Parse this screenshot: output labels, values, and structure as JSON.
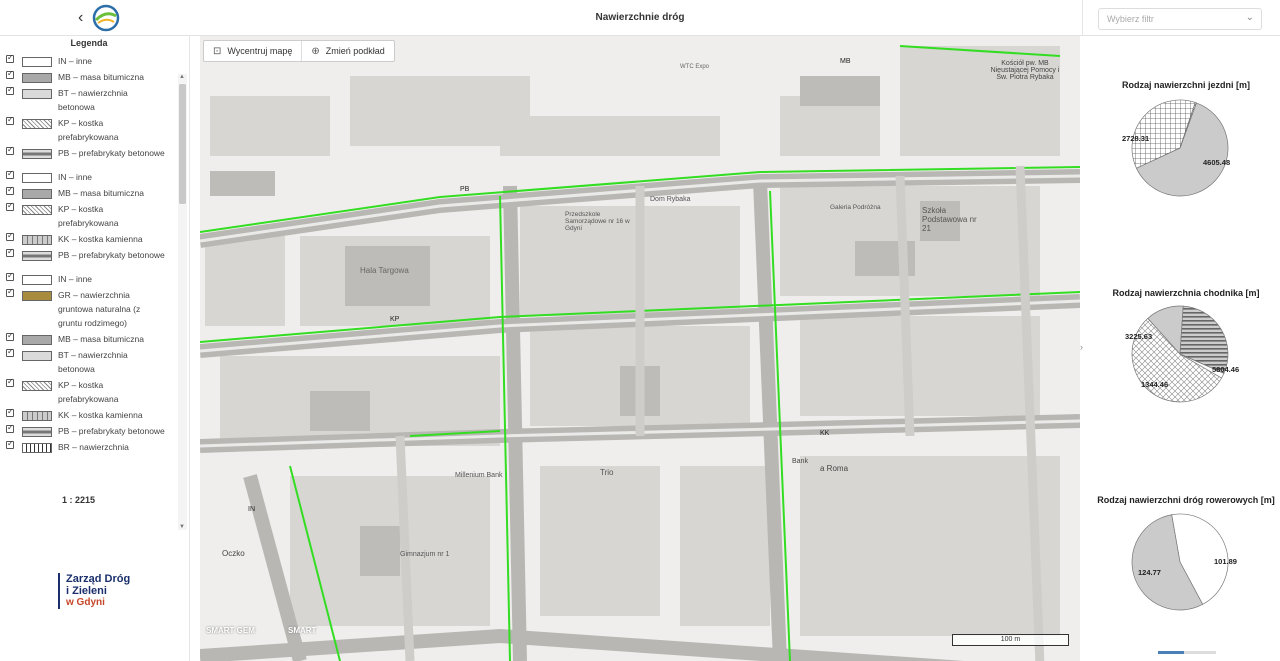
{
  "header": {
    "title": "Nawierzchnie dróg",
    "back_icon": "chevron-left-icon",
    "logo_icon": "app-logo-icon"
  },
  "filter": {
    "placeholder": "Wybierz filtr"
  },
  "legend": {
    "title": "Legenda",
    "groups": [
      {
        "items": [
          {
            "label": "IN – inne",
            "swatch": "white"
          },
          {
            "label": "MB – masa bitumiczna",
            "swatch": "mb"
          },
          {
            "label": "BT – nawierzchnia betonowa",
            "swatch": "bt"
          },
          {
            "label": "KP – kostka prefabrykowana",
            "swatch": "kp"
          },
          {
            "label": "PB – prefabrykaty betonowe",
            "swatch": "pb"
          }
        ]
      },
      {
        "items": [
          {
            "label": "IN – inne",
            "swatch": "white"
          },
          {
            "label": "MB – masa bitumiczna",
            "swatch": "mb"
          },
          {
            "label": "KP – kostka prefabrykowana",
            "swatch": "kp"
          },
          {
            "label": "KK – kostka kamienna",
            "swatch": "kk"
          },
          {
            "label": "PB – prefabrykaty betonowe",
            "swatch": "pb"
          }
        ]
      },
      {
        "items": [
          {
            "label": "IN – inne",
            "swatch": "white"
          },
          {
            "label": "GR – nawierzchnia gruntowa naturalna (z gruntu rodzimego)",
            "swatch": "gr"
          },
          {
            "label": "MB – masa bitumiczna",
            "swatch": "mb"
          },
          {
            "label": "BT – nawierzchnia betonowa",
            "swatch": "bt"
          },
          {
            "label": "KP – kostka prefabrykowana",
            "swatch": "kp"
          },
          {
            "label": "KK – kostka kamienna",
            "swatch": "kk"
          },
          {
            "label": "PB – prefabrykaty betonowe",
            "swatch": "pb"
          },
          {
            "label": "BR – nawierzchnia",
            "swatch": "br"
          }
        ]
      }
    ],
    "scale": "1 : 2215",
    "org_logo": {
      "line1": "Zarząd Dróg",
      "line2": "i Zieleni",
      "line3": "w Gdyni"
    }
  },
  "map": {
    "buttons": {
      "center": "Wycentruj mapę",
      "basemap": "Zmień podkład"
    },
    "scalebar": "100 m",
    "labels": {
      "street_codes": [
        "MB",
        "PB",
        "KP",
        "KK",
        "IN"
      ],
      "places": [
        "Hala Targowa",
        "Szkoła Podstawowa nr 21",
        "Przedszkole Samorządowe nr 16 w Gdyni",
        "Millenium Bank",
        "Gimnazjum nr 1",
        "Kościół pw. MB Nieustającej Pomocy i Św. Piotra Rybaka",
        "Galeria Podróżna",
        "Trio",
        "Dom Rybaka",
        "a Roma",
        "Bank",
        "Oczko",
        "WTC Expo"
      ],
      "brands": [
        "SMART GEM",
        "SMART"
      ]
    }
  },
  "colors": {
    "accent": "#4a7fb8",
    "green_line": "#33dd22",
    "pie_fill": "#cbcbcb",
    "org_blue": "#1a2f6b",
    "org_red": "#c7462a"
  },
  "chart_data": [
    {
      "type": "pie",
      "title": "Rodzaj nawierzchni jezdni [m]",
      "slices": [
        {
          "value": 4605.48,
          "pattern": "solid"
        },
        {
          "value": 2728.31,
          "pattern": "grid"
        },
        {
          "value": 30,
          "pattern": "hatch"
        }
      ]
    },
    {
      "type": "pie",
      "title": "Rodzaj nawierzchnia chodnika [m]",
      "slices": [
        {
          "value": 5804.46,
          "pattern": "crosshatch"
        },
        {
          "value": 1344.46,
          "pattern": "solid"
        },
        {
          "value": 3225.63,
          "pattern": "stripes"
        },
        {
          "value": 180,
          "pattern": "white"
        }
      ]
    },
    {
      "type": "pie",
      "title": "Rodzaj nawierzchni dróg rowerowych [m]",
      "slices": [
        {
          "value": 101.89,
          "pattern": "white"
        },
        {
          "value": 124.77,
          "pattern": "solid"
        }
      ]
    }
  ]
}
